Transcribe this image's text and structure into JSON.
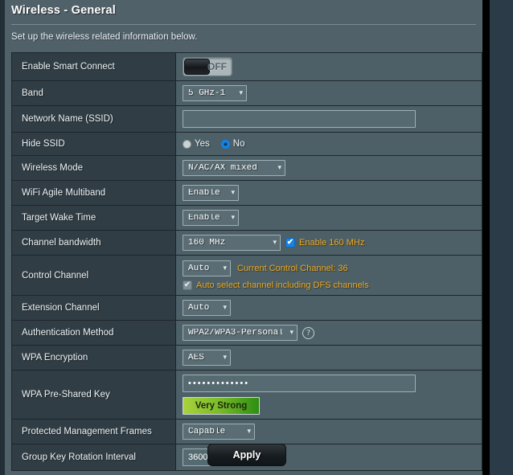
{
  "page": {
    "title": "Wireless - General",
    "subtitle": "Set up the wireless related information below."
  },
  "rows": {
    "smart_connect": {
      "label": "Enable Smart Connect",
      "toggle_state": "OFF"
    },
    "band": {
      "label": "Band",
      "value": "5 GHz-1"
    },
    "ssid": {
      "label": "Network Name (SSID)",
      "value": "",
      "placeholder": ""
    },
    "hide_ssid": {
      "label": "Hide SSID",
      "options": [
        "Yes",
        "No"
      ],
      "selected": "No"
    },
    "wireless_mode": {
      "label": "Wireless Mode",
      "value": "N/AC/AX mixed"
    },
    "agile_multiband": {
      "label": "WiFi Agile Multiband",
      "value": "Enable"
    },
    "target_wake_time": {
      "label": "Target Wake Time",
      "value": "Enable"
    },
    "channel_bandwidth": {
      "label": "Channel bandwidth",
      "value": "160 MHz",
      "checkbox_label": "Enable 160 MHz",
      "checkbox_checked": true,
      "checkbox_mark": "✔"
    },
    "control_channel": {
      "label": "Control Channel",
      "value": "Auto",
      "note": "Current Control Channel: 36",
      "dfs_label": "Auto select channel including DFS channels",
      "dfs_checked": true,
      "dfs_mark": "✔"
    },
    "extension_channel": {
      "label": "Extension Channel",
      "value": "Auto"
    },
    "auth_method": {
      "label": "Authentication Method",
      "value": "WPA2/WPA3-Personal",
      "help_icon": "question-mark-icon",
      "help_glyph": "?"
    },
    "wpa_encryption": {
      "label": "WPA Encryption",
      "value": "AES"
    },
    "psk": {
      "label": "WPA Pre-Shared Key",
      "value": "•••••••••••••",
      "strength": "Very Strong"
    },
    "pmf": {
      "label": "Protected Management Frames",
      "value": "Capable"
    },
    "group_key_rotation": {
      "label": "Group Key Rotation Interval",
      "value": "3600"
    }
  },
  "footer": {
    "apply_label": "Apply"
  },
  "colors": {
    "accent_orange": "#f0a91e",
    "accent_blue": "#1b82e0",
    "panel": "#51616a",
    "label_cell": "#303d44",
    "value_cell": "#4d6067",
    "strength_green": "#7dbd2a"
  }
}
